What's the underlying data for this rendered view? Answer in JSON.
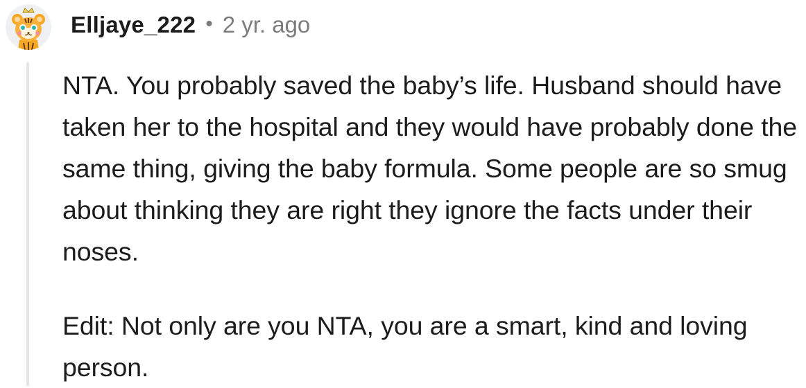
{
  "comment": {
    "avatar_icon": "tiger-avatar-icon",
    "username": "Elljaye_222",
    "separator": "•",
    "timestamp": "2 yr. ago",
    "paragraphs": [
      "NTA. You probably saved the baby’s life. Husband should have taken her to the hospital and they would have probably done the same thing, giving the baby formula. Some people are so smug about thinking they are right they ignore the facts under their noses.",
      "Edit: Not only are you NTA, you are a smart, kind and loving person."
    ]
  }
}
